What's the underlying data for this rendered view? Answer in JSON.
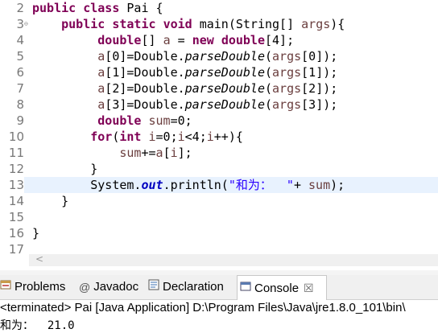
{
  "editor": {
    "lines": [
      {
        "num": "2",
        "fold": "",
        "hl": false,
        "tokens": [
          {
            "t": "public",
            "c": "k"
          },
          {
            "t": " "
          },
          {
            "t": "class",
            "c": "k"
          },
          {
            "t": " Pai {"
          }
        ]
      },
      {
        "num": "3",
        "fold": "⊖",
        "hl": false,
        "tokens": [
          {
            "t": "    "
          },
          {
            "t": "public",
            "c": "k"
          },
          {
            "t": " "
          },
          {
            "t": "static",
            "c": "k"
          },
          {
            "t": " "
          },
          {
            "t": "void",
            "c": "k"
          },
          {
            "t": " main(String[] "
          },
          {
            "t": "args",
            "c": "v"
          },
          {
            "t": "){"
          }
        ]
      },
      {
        "num": "4",
        "fold": "",
        "hl": false,
        "tokens": [
          {
            "t": "         "
          },
          {
            "t": "double",
            "c": "k"
          },
          {
            "t": "[] "
          },
          {
            "t": "a",
            "c": "v"
          },
          {
            "t": " = "
          },
          {
            "t": "new",
            "c": "k"
          },
          {
            "t": " "
          },
          {
            "t": "double",
            "c": "k"
          },
          {
            "t": "[4];"
          }
        ]
      },
      {
        "num": "5",
        "fold": "",
        "hl": false,
        "tokens": [
          {
            "t": "         "
          },
          {
            "t": "a",
            "c": "v"
          },
          {
            "t": "[0]=Double."
          },
          {
            "t": "parseDouble",
            "c": "i"
          },
          {
            "t": "("
          },
          {
            "t": "args",
            "c": "v"
          },
          {
            "t": "[0]);"
          }
        ]
      },
      {
        "num": "6",
        "fold": "",
        "hl": false,
        "tokens": [
          {
            "t": "         "
          },
          {
            "t": "a",
            "c": "v"
          },
          {
            "t": "[1]=Double."
          },
          {
            "t": "parseDouble",
            "c": "i"
          },
          {
            "t": "("
          },
          {
            "t": "args",
            "c": "v"
          },
          {
            "t": "[1]);"
          }
        ]
      },
      {
        "num": "7",
        "fold": "",
        "hl": false,
        "tokens": [
          {
            "t": "         "
          },
          {
            "t": "a",
            "c": "v"
          },
          {
            "t": "[2]=Double."
          },
          {
            "t": "parseDouble",
            "c": "i"
          },
          {
            "t": "("
          },
          {
            "t": "args",
            "c": "v"
          },
          {
            "t": "[2]);"
          }
        ]
      },
      {
        "num": "8",
        "fold": "",
        "hl": false,
        "tokens": [
          {
            "t": "         "
          },
          {
            "t": "a",
            "c": "v"
          },
          {
            "t": "[3]=Double."
          },
          {
            "t": "parseDouble",
            "c": "i"
          },
          {
            "t": "("
          },
          {
            "t": "args",
            "c": "v"
          },
          {
            "t": "[3]);"
          }
        ]
      },
      {
        "num": "9",
        "fold": "",
        "hl": false,
        "tokens": [
          {
            "t": "         "
          },
          {
            "t": "double",
            "c": "k"
          },
          {
            "t": " "
          },
          {
            "t": "sum",
            "c": "v"
          },
          {
            "t": "=0;"
          }
        ]
      },
      {
        "num": "10",
        "fold": "",
        "hl": false,
        "tokens": [
          {
            "t": "        "
          },
          {
            "t": "for",
            "c": "k"
          },
          {
            "t": "("
          },
          {
            "t": "int",
            "c": "k"
          },
          {
            "t": " "
          },
          {
            "t": "i",
            "c": "v"
          },
          {
            "t": "=0;"
          },
          {
            "t": "i",
            "c": "v"
          },
          {
            "t": "<4;"
          },
          {
            "t": "i",
            "c": "v"
          },
          {
            "t": "++){"
          }
        ]
      },
      {
        "num": "11",
        "fold": "",
        "hl": false,
        "tokens": [
          {
            "t": "            "
          },
          {
            "t": "sum",
            "c": "v"
          },
          {
            "t": "+="
          },
          {
            "t": "a",
            "c": "v"
          },
          {
            "t": "["
          },
          {
            "t": "i",
            "c": "v"
          },
          {
            "t": "];"
          }
        ]
      },
      {
        "num": "12",
        "fold": "",
        "hl": false,
        "tokens": [
          {
            "t": "        }"
          }
        ]
      },
      {
        "num": "13",
        "fold": "",
        "hl": true,
        "tokens": [
          {
            "t": "        System."
          },
          {
            "t": "out",
            "c": "f"
          },
          {
            "t": ".println("
          },
          {
            "t": "\"和为：  \"",
            "c": "s"
          },
          {
            "t": "+ "
          },
          {
            "t": "sum",
            "c": "v"
          },
          {
            "t": ");"
          }
        ]
      },
      {
        "num": "14",
        "fold": "",
        "hl": false,
        "tokens": [
          {
            "t": "    }"
          }
        ]
      },
      {
        "num": "15",
        "fold": "",
        "hl": false,
        "tokens": []
      },
      {
        "num": "16",
        "fold": "",
        "hl": false,
        "tokens": [
          {
            "t": "}"
          }
        ]
      },
      {
        "num": "17",
        "fold": "",
        "hl": false,
        "tokens": []
      }
    ]
  },
  "scroll_left_arrow": "<",
  "tabs": [
    {
      "label": "Problems",
      "icon": "problems-icon",
      "active": false
    },
    {
      "label": "Javadoc",
      "icon": "javadoc-icon",
      "glyph": "@",
      "active": false
    },
    {
      "label": "Declaration",
      "icon": "declaration-icon",
      "active": false
    },
    {
      "label": "Console",
      "icon": "console-icon",
      "active": true,
      "close": "☒"
    }
  ],
  "console": {
    "header": "<terminated> Pai [Java Application] D:\\Program Files\\Java\\jre1.8.0_101\\bin\\",
    "output": "和为：  21.0"
  },
  "colors": {
    "keyword": "#7f0055",
    "variable": "#6a3e3e",
    "field": "#0000c0",
    "string": "#2a00ff",
    "line_highlight": "#e8f2fe",
    "line_number": "#787878"
  }
}
